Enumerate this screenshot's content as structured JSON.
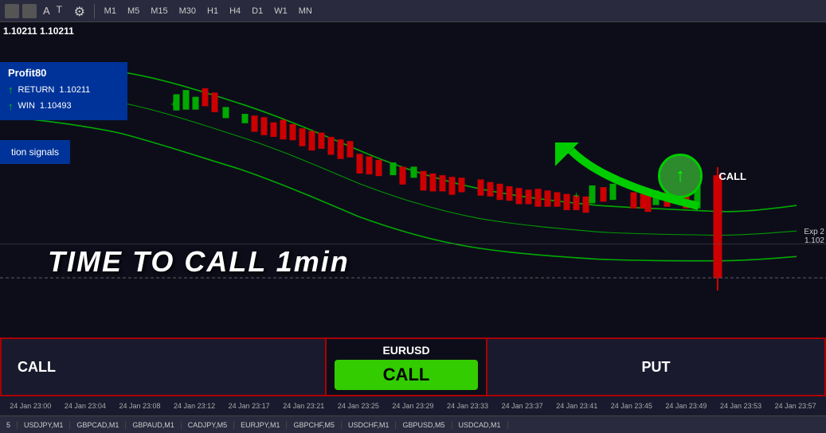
{
  "toolbar": {
    "timeframes": [
      "M1",
      "M5",
      "M15",
      "M30",
      "H1",
      "H4",
      "D1",
      "W1",
      "MN"
    ]
  },
  "chart": {
    "price_display": "1.10211  1.10211",
    "exp_label": "Exp 2",
    "exp_price": "1.102"
  },
  "profit_box": {
    "title": "Profit80",
    "return_label": "RETURN",
    "return_value": "1.10211",
    "win_label": "WIN",
    "win_value": "1.10493"
  },
  "signal_box": {
    "text": "tion signals"
  },
  "signal": {
    "time_to_call": "TIME TO CALL 1min",
    "call_near": "CALL"
  },
  "bottom_panel": {
    "call_label": "CALL",
    "pair_label": "EURUSD",
    "call_btn": "CALL",
    "put_label": "PUT"
  },
  "time_axis": {
    "ticks": [
      "24 Jan 23:00",
      "24 Jan 23:04",
      "24 Jan 23:08",
      "24 Jan 23:12",
      "24 Jan 23:17",
      "24 Jan 23:21",
      "24 Jan 23:25",
      "24 Jan 23:29",
      "24 Jan 23:33",
      "24 Jan 23:37",
      "24 Jan 23:41",
      "24 Jan 23:45",
      "24 Jan 23:49",
      "24 Jan 23:53",
      "24 Jan 23:57"
    ]
  },
  "symbol_bar": {
    "symbols": [
      "5",
      "USDJPY,M1",
      "GBPCAD,M1",
      "GBPAUD,M1",
      "CADJPY,M5",
      "EURJPY,M1",
      "GBPCHF,M5",
      "USDCHF,M1",
      "GBPUSD,M5",
      "USDCAD,M1"
    ]
  }
}
